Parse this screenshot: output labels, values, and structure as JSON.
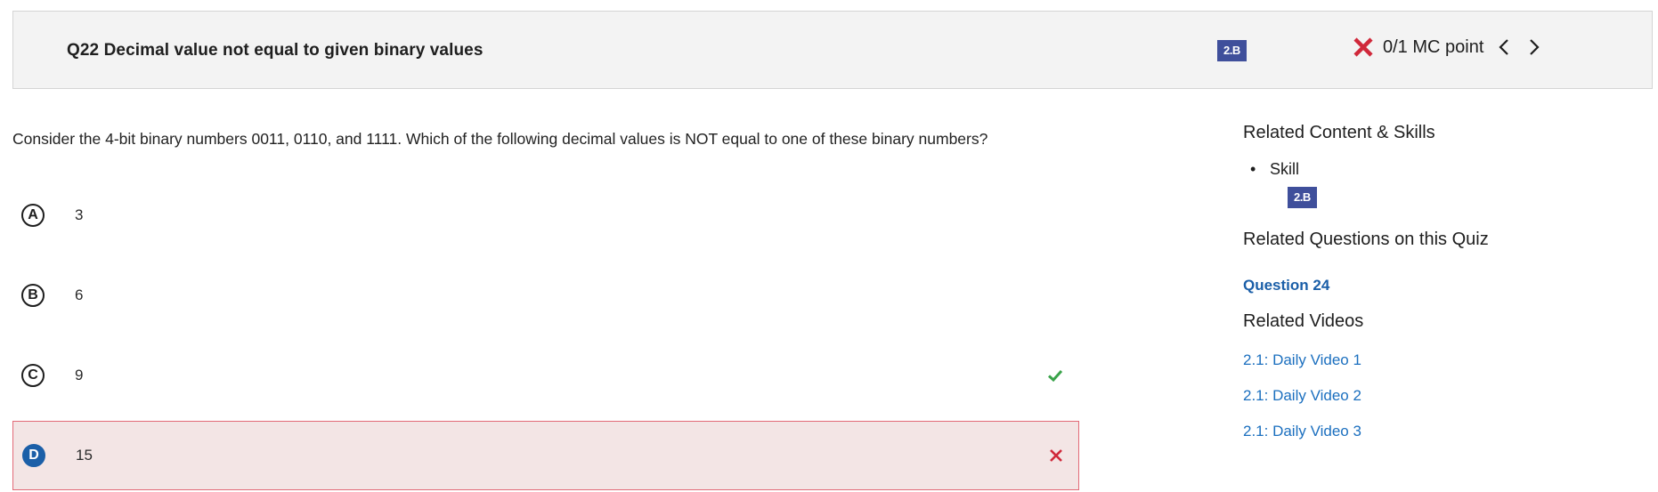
{
  "header": {
    "question_title": "Q22 Decimal value not equal to given binary values",
    "skill_badge": "2.B",
    "score": "0/1 MC point",
    "status_icon": "x-icon",
    "prev_icon": "chevron-left-icon",
    "next_icon": "chevron-right-icon"
  },
  "question": {
    "text": "Consider the 4-bit binary numbers 0011, 0110, and 1111. Which of the following decimal values is NOT equal to one of these binary numbers?"
  },
  "choices": [
    {
      "letter": "A",
      "value": "3",
      "state": "none"
    },
    {
      "letter": "B",
      "value": "6",
      "state": "none"
    },
    {
      "letter": "C",
      "value": "9",
      "state": "correct",
      "mark_icon": "check-icon"
    },
    {
      "letter": "D",
      "value": "15",
      "state": "selected-wrong",
      "mark_icon": "x-icon"
    }
  ],
  "sidebar": {
    "related_content_heading": "Related Content & Skills",
    "skill_label": "Skill",
    "skill_badge": "2.B",
    "related_questions_heading": "Related Questions on this Quiz",
    "related_question_link": "Question 24",
    "related_videos_heading": "Related Videos",
    "videos": [
      "2.1: Daily Video 1",
      "2.1: Daily Video 2",
      "2.1: Daily Video 3"
    ]
  },
  "colors": {
    "badge": "#3f4f9b",
    "wrong": "#d0283a",
    "correct": "#3aa34a",
    "link": "#1b6fbf",
    "wrong_bg": "#f3e5e5"
  }
}
